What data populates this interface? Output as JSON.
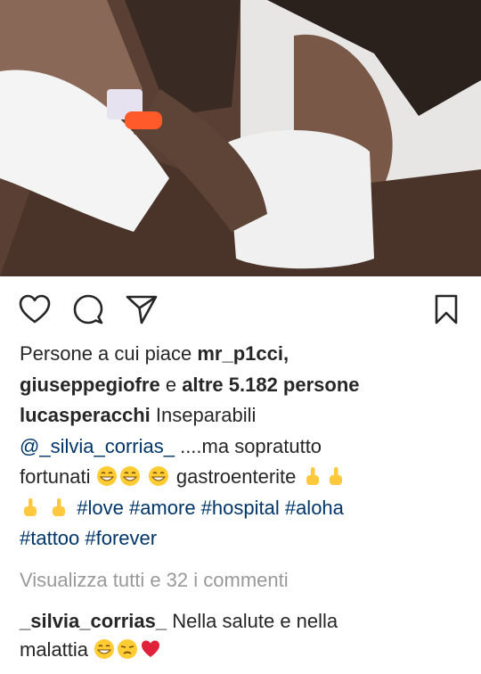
{
  "post": {
    "image_alt": "photo",
    "likes": {
      "prefix": "Persone a cui piace",
      "user1": "mr_p1cci,",
      "user2": "giuseppegiofre",
      "conj": "e",
      "others": "altre 5.182 persone"
    },
    "caption": {
      "author": "lucasperacchi",
      "text1": "Inseparabili",
      "mention": "@_silvia_corrias_",
      "text2": "....ma sopratutto",
      "text3": "fortunati",
      "text4": "gastroenterite",
      "hashtags1": "#love #amore #hospital #aloha",
      "hashtags2": "#tattoo #forever"
    },
    "view_comments": "Visualizza tutti e 32 i commenti",
    "comment": {
      "author": "_silvia_corrias_",
      "text1": "Nella salute e nella",
      "text2": "malattia"
    }
  },
  "icons": {
    "like": "heart-icon",
    "comment": "comment-bubble-icon",
    "share": "share-arrow-icon",
    "save": "bookmark-icon"
  },
  "colors": {
    "text": "#262626",
    "link": "#003569",
    "muted": "#999999"
  }
}
